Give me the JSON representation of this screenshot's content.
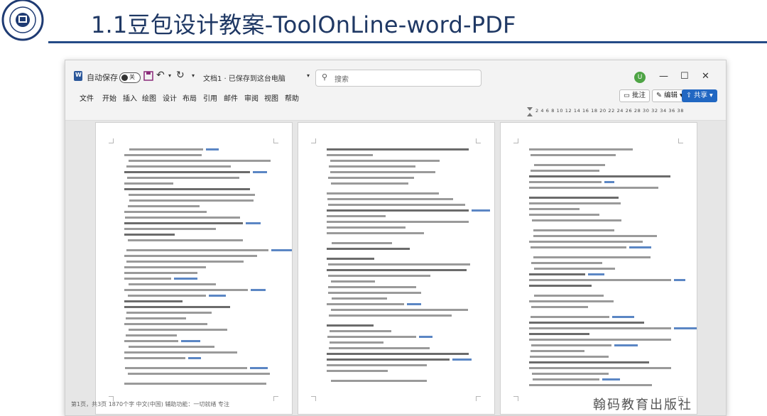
{
  "slide": {
    "title": "1.1豆包设计教案-ToolOnLine-word-PDF",
    "logo_icon": "university-seal-icon",
    "rule_color": "#244b86"
  },
  "window": {
    "autosave_label": "自动保存",
    "autosave_state": "关",
    "doc_title": "文档1 · 已保存到这台电脑",
    "search_placeholder": "搜索",
    "avatar_letter": "U",
    "menus": [
      "文件",
      "开始",
      "插入",
      "绘图",
      "设计",
      "布局",
      "引用",
      "邮件",
      "审阅",
      "视图",
      "帮助"
    ],
    "comments_label": "批注",
    "editing_label": "编辑",
    "share_label": "共享",
    "ruler_numbers": "2 4 6 8 10 12 14 16 18 20 22 24 26 28 30 32 34 36 38"
  },
  "watermark": "翰码教育出版社",
  "status": "第1页，共3页  1870个字  中文(中国)  辅助功能：一切就绪  专注"
}
